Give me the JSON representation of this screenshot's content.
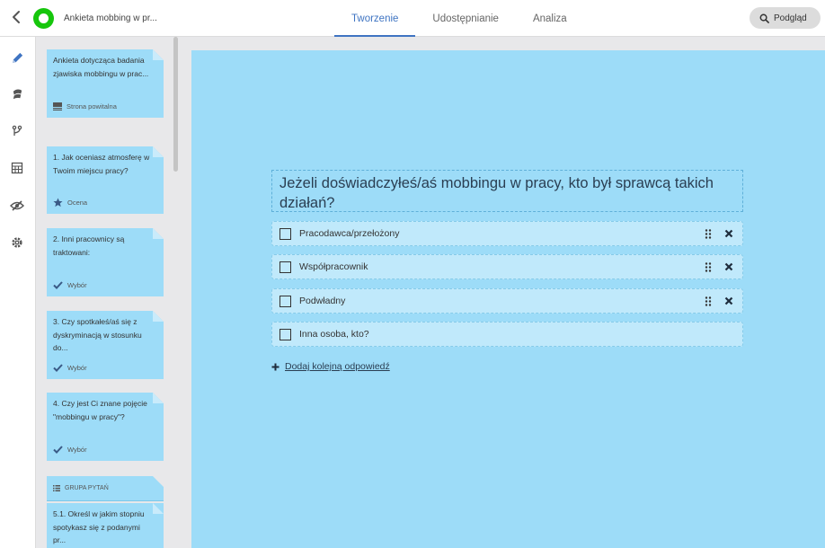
{
  "header": {
    "survey_title": "Ankieta mobbing w pr...",
    "tabs": [
      {
        "label": "Tworzenie",
        "active": true
      },
      {
        "label": "Udostępnianie",
        "active": false
      },
      {
        "label": "Analiza",
        "active": false
      }
    ],
    "preview_label": "Podgląd"
  },
  "rail": {
    "icons": [
      "pencil-icon",
      "theme-icon",
      "logic-icon",
      "calculator-icon",
      "eye-hidden-icon",
      "settings-icon"
    ],
    "active_color": "#3f74c2"
  },
  "sidebar": {
    "welcome": {
      "text": "Ankieta dotycząca badania zjawiska mobbingu w prac...",
      "type": "Strona powitalna"
    },
    "questions": [
      {
        "text": "1. Jak oceniasz atmosferę w Twoim miejscu pracy?",
        "type": "Ocena"
      },
      {
        "text": "2. Inni pracownicy są traktowani:",
        "type": "Wybór"
      },
      {
        "text": "3. Czy spotkałeś/aś się z dyskryminacją w stosunku do...",
        "type": "Wybór"
      },
      {
        "text": "4. Czy jest Ci znane pojęcie \"mobbingu w pracy\"?",
        "type": "Wybór"
      }
    ],
    "group_label": "GRUPA PYTAŃ",
    "group_question": "5.1. Określ w jakim stopniu spotykasz się z podanymi pr..."
  },
  "editor": {
    "question": "Jeżeli doświadczyłeś/aś mobbingu w pracy, kto był sprawcą takich działań?",
    "answers": [
      "Pracodawca/przełożony",
      "Współpracownik",
      "Podwładny",
      "Inna osoba, kto?"
    ],
    "add_answer": "Dodaj kolejną odpowiedź"
  },
  "colors": {
    "canvas": "#9ddcf8",
    "accent": "#3f74c2",
    "logo": "#16c60c"
  }
}
